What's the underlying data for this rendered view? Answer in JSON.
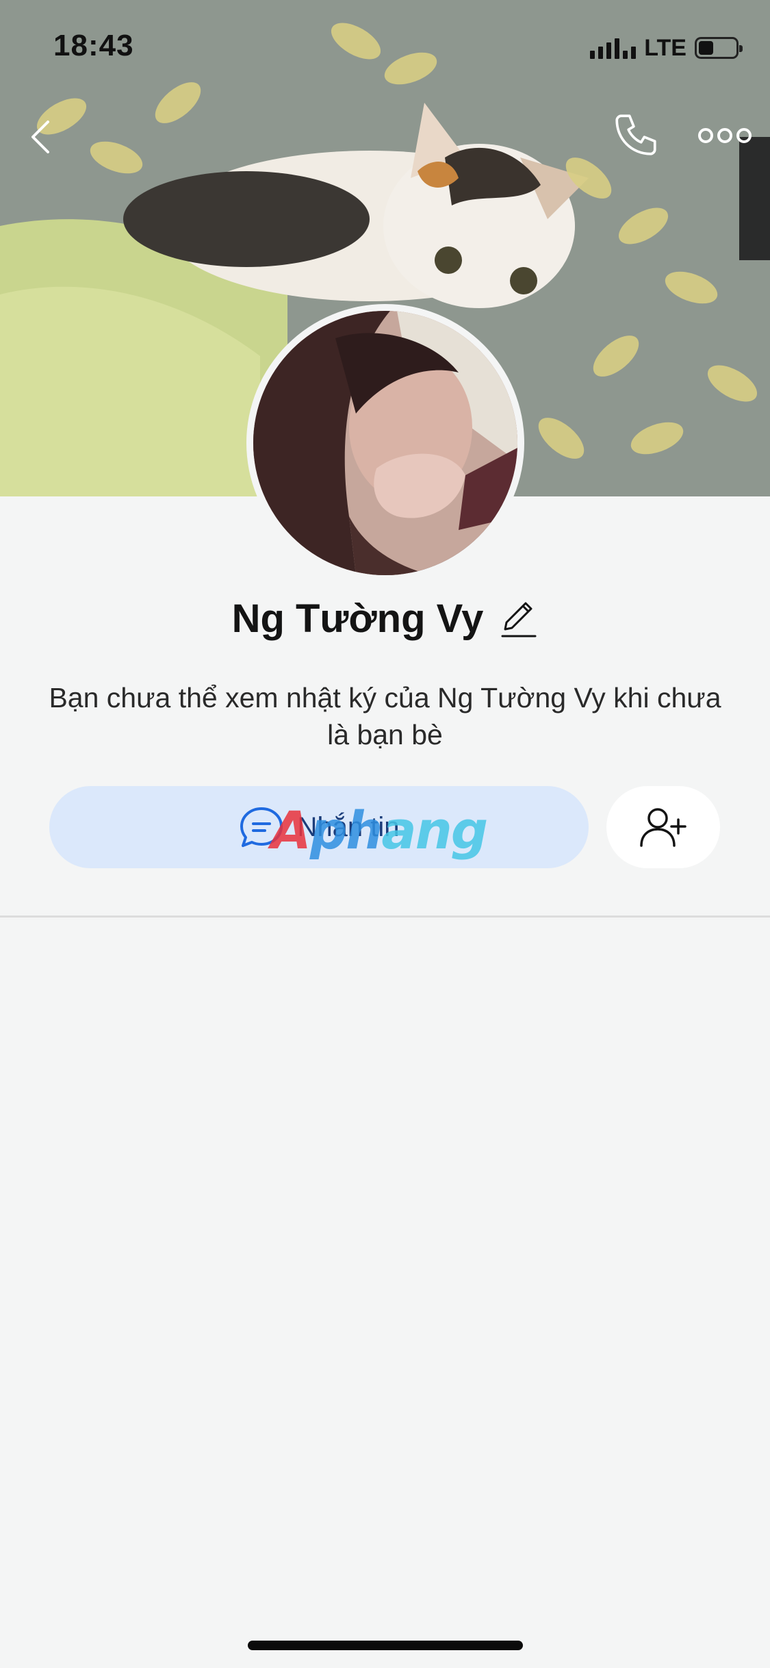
{
  "status_bar": {
    "time": "18:43",
    "network": "LTE",
    "battery_level": 0.4
  },
  "nav": {
    "back_icon": "chevron-left-icon",
    "call_icon": "phone-icon",
    "more_icon": "ellipsis-icon"
  },
  "profile": {
    "name": "Ng Tường Vy",
    "edit_icon": "pencil-icon",
    "diary_note": "Bạn chưa thể xem nhật ký của Ng Tường Vy khi chưa là bạn bè"
  },
  "actions": {
    "message_label": "Nhắn tin",
    "message_icon": "chat-bubble-icon",
    "add_friend_icon": "add-user-icon"
  },
  "watermark": {
    "part1": "A",
    "part2": "ph",
    "part3": "ang"
  },
  "colors": {
    "background": "#f4f5f5",
    "message_button_bg": "#dbe8fb",
    "accent_blue": "#1f6ae0"
  }
}
